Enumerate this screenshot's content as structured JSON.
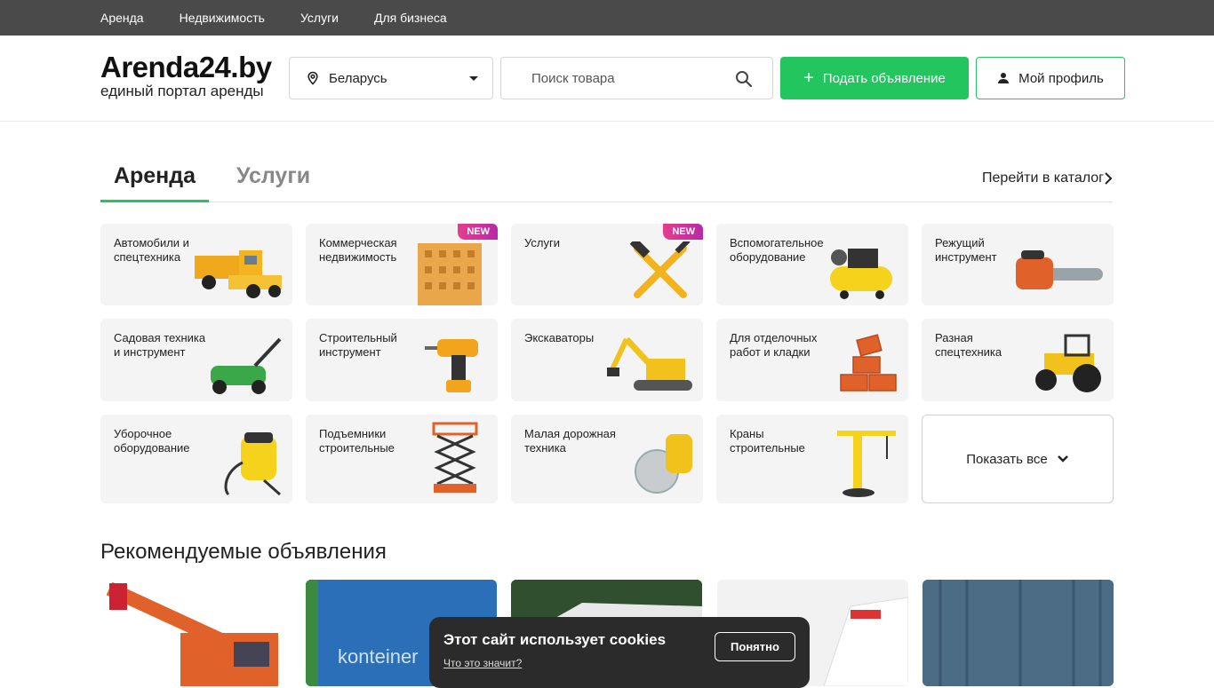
{
  "topnav": [
    "Аренда",
    "Недвижимость",
    "Услуги",
    "Для бизнеса"
  ],
  "logo": {
    "title": "Arenda24.by",
    "subtitle": "единый портал аренды"
  },
  "region": {
    "value": "Беларусь",
    "icon": "map-pin-icon"
  },
  "search": {
    "placeholder": "Поиск товара",
    "icon": "search-icon"
  },
  "buttons": {
    "add": "Подать объявление",
    "add_icon": "plus-icon",
    "profile": "Мой профиль",
    "profile_icon": "user-icon"
  },
  "tabs": {
    "active": "Аренда",
    "inactive": "Услуги",
    "catalog": "Перейти в каталог"
  },
  "categories": [
    {
      "label": "Автомобили и спецтехника",
      "badge": ""
    },
    {
      "label": "Коммерческая недвижимость",
      "badge": "NEW"
    },
    {
      "label": "Услуги",
      "badge": "NEW"
    },
    {
      "label": "Вспомогательное оборудование",
      "badge": ""
    },
    {
      "label": "Режущий инструмент",
      "badge": ""
    },
    {
      "label": "Садовая техника и инструмент",
      "badge": ""
    },
    {
      "label": "Строительный инструмент",
      "badge": ""
    },
    {
      "label": "Экскаваторы",
      "badge": ""
    },
    {
      "label": "Для отделочных работ и кладки",
      "badge": ""
    },
    {
      "label": "Разная спецтехника",
      "badge": ""
    },
    {
      "label": "Уборочное оборудование",
      "badge": ""
    },
    {
      "label": "Подъемники строительные",
      "badge": ""
    },
    {
      "label": "Малая дорожная техника",
      "badge": ""
    },
    {
      "label": "Краны строительные",
      "badge": ""
    }
  ],
  "show_all": "Показать все",
  "recommended": {
    "title": "Рекомендуемые объявления",
    "listing_text": "konteiner"
  },
  "cookie": {
    "title": "Этот сайт использует cookies",
    "link": "Что это значит?",
    "button": "Понятно"
  },
  "colors": {
    "accent": "#22c55e",
    "topnav": "#4a4a4a",
    "badge": "#d5338f",
    "cookie_bg": "#2b2b2b"
  }
}
